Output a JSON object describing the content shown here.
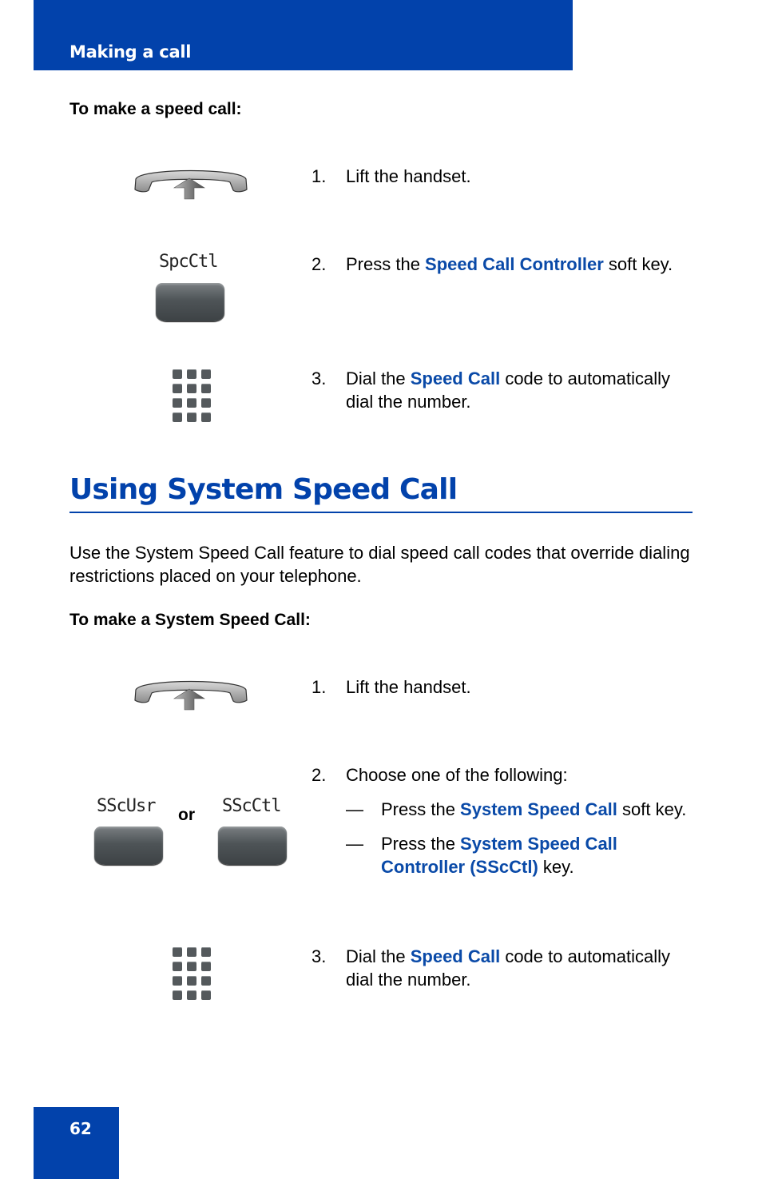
{
  "header": {
    "title": "Making a call",
    "band_color": "#0242ab"
  },
  "speed_call": {
    "heading": "To make a speed call:",
    "steps": [
      {
        "num": "1.",
        "text": "Lift the handset.",
        "icon": "handset-lift-icon"
      },
      {
        "num": "2.",
        "pre": "Press the ",
        "highlight": "Speed Call Controller",
        "post": " soft key.",
        "icon": "softkey-button",
        "softkey_label": "SpcCtl"
      },
      {
        "num": "3.",
        "pre": "Dial the ",
        "highlight": "Speed Call",
        "post": " code to automatically dial the number.",
        "icon": "dialpad-icon"
      }
    ]
  },
  "system_speed_call": {
    "title": "Using System Speed Call",
    "intro": "Use the System Speed Call feature to dial speed call codes that override dialing restrictions placed on your telephone.",
    "heading": "To make a System Speed Call:",
    "steps": [
      {
        "num": "1.",
        "text": "Lift the handset.",
        "icon": "handset-lift-icon"
      },
      {
        "num": "2.",
        "text": "Choose one of the following:",
        "softkey_labels": [
          "SScUsr",
          "SScCtl"
        ],
        "or_label": "or",
        "options": [
          {
            "dash": "—",
            "pre": "Press the ",
            "highlight": "System Speed Call",
            "post": " soft key."
          },
          {
            "dash": "—",
            "pre": "Press the ",
            "highlight": "System Speed Call Controller (SScCtl)",
            "post": " key."
          }
        ]
      },
      {
        "num": "3.",
        "pre": "Dial the ",
        "highlight": "Speed Call",
        "post": " code to automatically dial the number.",
        "icon": "dialpad-icon"
      }
    ]
  },
  "footer": {
    "page_number": "62"
  },
  "colors": {
    "brand_blue": "#0242ab",
    "highlight_blue": "#0a4aa8"
  }
}
